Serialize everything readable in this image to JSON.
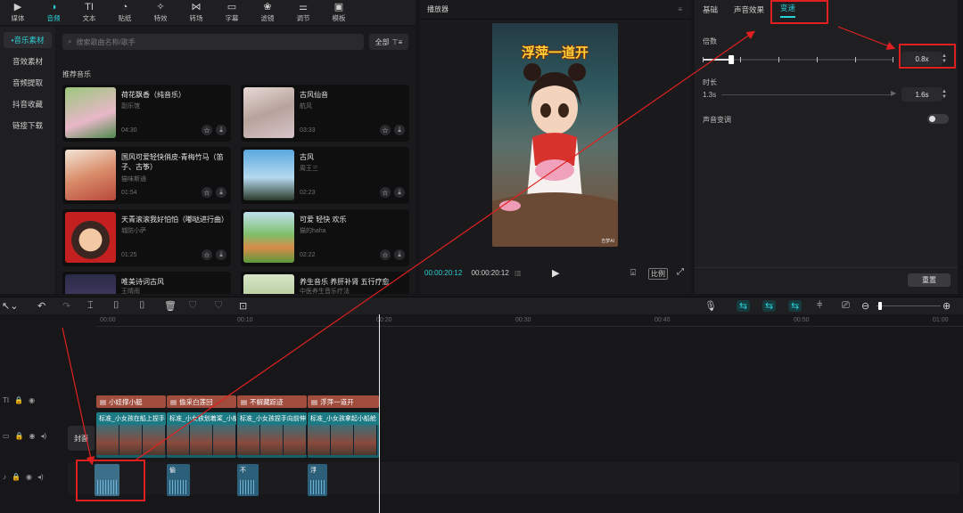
{
  "toolbar": {
    "items": [
      {
        "label": "媒体",
        "icon": "media-icon"
      },
      {
        "label": "音频",
        "icon": "audio-icon"
      },
      {
        "label": "文本",
        "icon": "text-icon"
      },
      {
        "label": "贴纸",
        "icon": "sticker-icon"
      },
      {
        "label": "特效",
        "icon": "effects-icon"
      },
      {
        "label": "转场",
        "icon": "transition-icon"
      },
      {
        "label": "字幕",
        "icon": "subtitle-icon"
      },
      {
        "label": "滤镜",
        "icon": "filter-icon"
      },
      {
        "label": "调节",
        "icon": "adjust-icon"
      },
      {
        "label": "模板",
        "icon": "template-icon"
      }
    ],
    "active": "音频"
  },
  "leftnav": {
    "items": [
      "音乐素材",
      "音效素材",
      "音频提取",
      "抖音收藏",
      "链接下载"
    ]
  },
  "music": {
    "search_placeholder": "搜索歌曲名称/歌手",
    "filter_label": "全部",
    "section_title": "推荐音乐",
    "cards": [
      {
        "title": "荷花飘香（纯音乐）",
        "artist": "副乐馆",
        "duration": "04:30"
      },
      {
        "title": "古风仙音",
        "artist": "航风",
        "duration": "03:33"
      },
      {
        "title": "国风可爱轻快俏皮-青梅竹马（笛子、古筝）",
        "artist": "猫味斯通",
        "duration": "01:54"
      },
      {
        "title": "古风",
        "artist": "周王三",
        "duration": "02:23"
      },
      {
        "title": "天青滚滚我好怕怕（嘟哒进行曲）",
        "artist": "城防小萨",
        "duration": "01:25"
      },
      {
        "title": "可爱 轻快 欢乐",
        "artist": "猫的haha",
        "duration": "02:22"
      },
      {
        "title": "唯美诗词古风",
        "artist": "王晴雨",
        "duration": ""
      },
      {
        "title": "养生音乐 养肝补肾 五行疗愈",
        "artist": "中医养生音乐疗法",
        "duration": ""
      }
    ]
  },
  "player": {
    "title": "播放器",
    "video_caption": "浮萍一道开",
    "watermark": "吉梦AI",
    "timecode_current": "00:00:20:12",
    "timecode_total": "00:00:20:12",
    "ratio_label": "比例"
  },
  "props": {
    "tabs": [
      "基础",
      "声音效果",
      "变速"
    ],
    "active_tab": "变速",
    "speed_label": "倍数",
    "speed_value": "0.8x",
    "speed_level": 0.15,
    "duration_label": "时长",
    "duration_from": "1.3s",
    "duration_value": "1.6s",
    "pitch_label": "声音变调",
    "pitch_enabled": false,
    "reset_label": "重置"
  },
  "timeline": {
    "ruler": [
      "00:00",
      "00:10",
      "00:20",
      "00:30",
      "00:40",
      "00:50",
      "01:00"
    ],
    "cover_label": "封面",
    "text_clips": [
      "小娃撑小艇",
      "偷采白莲回",
      "不解藏踪迹",
      "浮萍一道开"
    ],
    "video_clips": [
      "标准_小女孩在船上捏手",
      "标准_小女孩划着桨_小船",
      "标准_小女孩捏手向前伸",
      "标准_小女孩拿起小船舱"
    ],
    "audio_clips": [
      "偷",
      "不",
      "浮"
    ],
    "colors": {
      "accent": "#2bd0d6",
      "text_clip": "#a14d3e",
      "video_clip": "#17606a",
      "annotation": "#e02020"
    }
  }
}
